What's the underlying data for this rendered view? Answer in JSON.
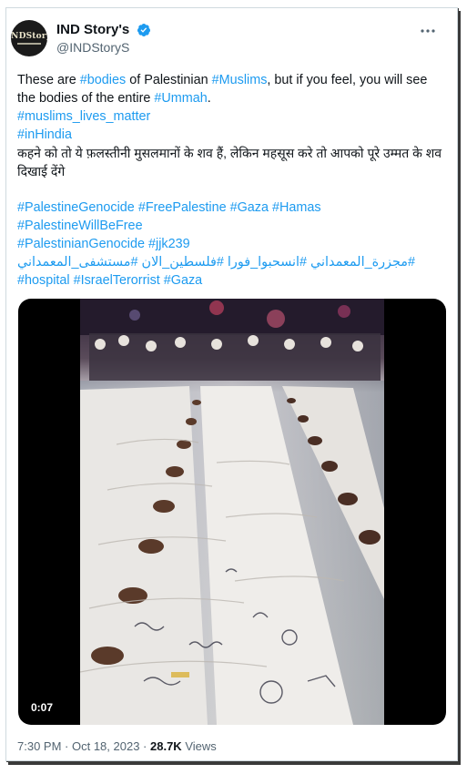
{
  "author": {
    "display_name": "IND Story's",
    "handle": "@INDStoryS",
    "avatar_text": "INDStory"
  },
  "tweet": {
    "line1_pre": "These are ",
    "line1_tag1": "#bodies",
    "line1_mid": " of Palestinian ",
    "line1_tag2": "#Muslims",
    "line1_post": ", but if you feel, you will see the bodies of the entire ",
    "line1_tag3": "#Ummah",
    "line1_end": ".",
    "tag_muslims_lives": "#muslims_lives_matter",
    "tag_inindia": "#inHindia",
    "hindi_text": "कहने को तो ये फ़लस्तीनी मुसलमानों के शव हैं, लेकिन महसूस करे तो आपको पूरे उम्मत के शव दिखाई देंगे",
    "tags_row1": [
      "#PalestineGenocide",
      "#FreePalestine",
      "#Gaza",
      "#Hamas"
    ],
    "tags_row2": [
      "#PalestineWillBeFree"
    ],
    "tags_row3": [
      "#PalestinianGenocide",
      "#jjk239"
    ],
    "tags_row4_arabic": "#مجزرة_المعمداني #انسحبوا_فورا #فلسطين_الان #مستشفى_المعمداني",
    "tags_row5": [
      "#hospital",
      "#IsraelTerorrist",
      "#Gaza"
    ]
  },
  "media": {
    "duration": "0:07"
  },
  "meta": {
    "time": "7:30 PM",
    "sep": " · ",
    "date": "Oct 18, 2023",
    "views_count": "28.7K",
    "views_label": " Views"
  },
  "colors": {
    "link": "#1d9bf0",
    "text": "#0f1419",
    "muted": "#536471"
  }
}
